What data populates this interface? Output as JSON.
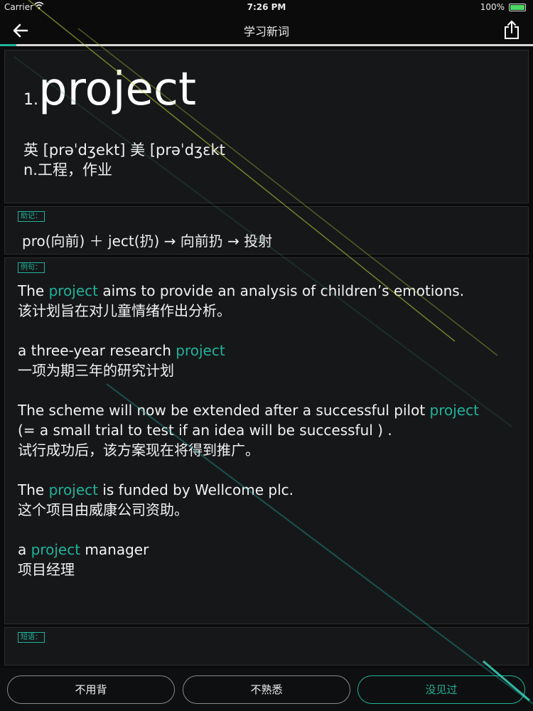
{
  "status": {
    "carrier": "Carrier",
    "time": "7:26 PM",
    "battery": "100%"
  },
  "nav": {
    "title": "学习新词",
    "progress_fraction": 0.03
  },
  "word": {
    "index": "1.",
    "text": "project",
    "phonetic": "英 [prəˈdʒekt] 美 [prəˈdʒɛkt",
    "meaning": "n.工程，作业"
  },
  "mnemonic": {
    "tag": "助记：",
    "text": "pro(向前) ＋ ject(扔) → 向前扔 → 投射"
  },
  "examples": {
    "tag": "例句：",
    "items": [
      {
        "en_before": "The ",
        "en_hl": "project",
        "en_after": " aims to provide an analysis of children’s emotions.",
        "en2": "",
        "zh": "该计划旨在对儿童情绪作出分析。"
      },
      {
        "en_before": "a three-year research ",
        "en_hl": "project",
        "en_after": "",
        "en2": "",
        "zh": "一项为期三年的研究计划"
      },
      {
        "en_before": "The scheme will now be extended after a successful pilot ",
        "en_hl": "project",
        "en_after": "",
        "en2": "(= a small trial to test if an idea will be successful ) .",
        "zh": "试行成功后，该方案现在将得到推广。"
      },
      {
        "en_before": "The ",
        "en_hl": "project",
        "en_after": " is funded by Wellcome plc.",
        "en2": "",
        "zh": "这个项目由威康公司资助。"
      },
      {
        "en_before": "a ",
        "en_hl": "project",
        "en_after": " manager",
        "en2": "",
        "zh": "项目经理"
      }
    ]
  },
  "phrases": {
    "tag": "短语："
  },
  "buttons": {
    "no_need": "不用背",
    "unfamiliar": "不熟悉",
    "never_seen": "没见过"
  },
  "colors": {
    "accent": "#1fb39a",
    "background": "#0b0b0c",
    "card": "#161719"
  }
}
